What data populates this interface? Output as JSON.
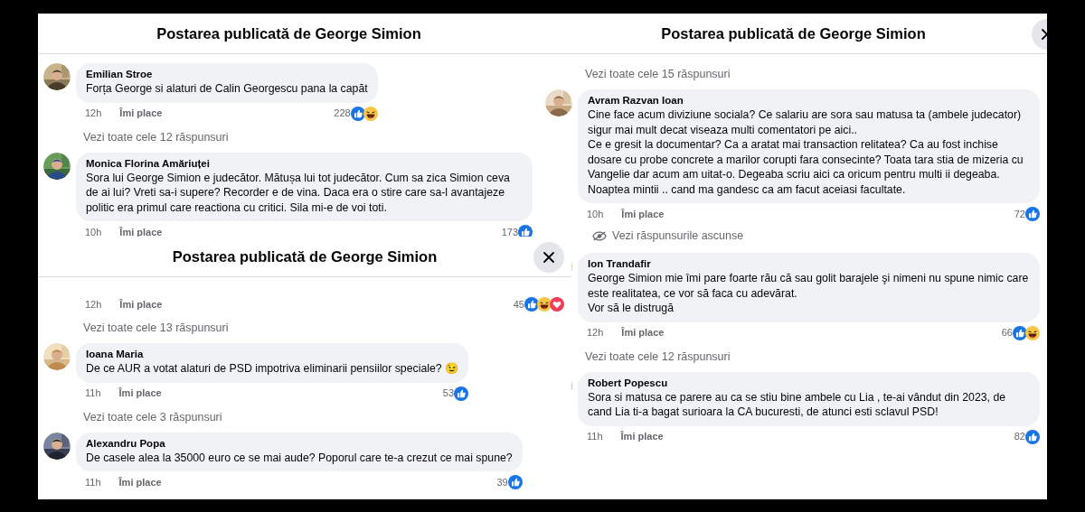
{
  "panels": [
    {
      "title": "Postarea publicată de George Simion",
      "items": [
        {
          "kind": "comment",
          "author": "Emilian Stroe",
          "text": "Forța George si alaturi de Calin Georgescu pana la capăt",
          "time": "12h",
          "like_label": "Îmi place",
          "count": "228",
          "reactions": [
            {
              "kind": "like"
            },
            {
              "kind": "haha"
            }
          ]
        },
        {
          "kind": "replies_link",
          "text": "Vezi toate cele 12 răspunsuri"
        },
        {
          "kind": "comment",
          "author": "Monica Florina Amăriuței",
          "text": "Sora lui George Simion e judecător. Mătușa lui tot judecător. Cum sa zica Simion ceva de ai lui? Vreti sa-i supere? Recorder e de vina. Daca era o stire care sa-l avantajeze politic era primul care reactiona cu critici. Sila mi-e de voi toti.",
          "time": "10h",
          "like_label": "Îmi place",
          "count": "173",
          "reactions": [
            {
              "kind": "like"
            }
          ]
        }
      ]
    },
    {
      "title": "Postarea publicată de George Simion",
      "close_button": true,
      "items": [
        {
          "kind": "comment",
          "time": "12h",
          "like_label": "Îmi place",
          "count": "45",
          "reactions": [
            {
              "kind": "like"
            },
            {
              "kind": "haha"
            },
            {
              "kind": "love"
            }
          ]
        },
        {
          "kind": "replies_link",
          "text": "Vezi toate cele 13 răspunsuri"
        },
        {
          "kind": "comment",
          "author": "Ioana Maria",
          "text": "De ce AUR a votat alaturi de PSD impotriva eliminarii pensiilor speciale? 😉",
          "time": "11h",
          "like_label": "Îmi place",
          "count": "53",
          "reactions": [
            {
              "kind": "like"
            }
          ]
        },
        {
          "kind": "replies_link",
          "text": "Vezi toate cele 3 răspunsuri"
        },
        {
          "kind": "comment",
          "author": "Alexandru Popa",
          "text": "De casele alea la 35000 euro ce se mai aude? Poporul care te-a crezut ce mai spune?",
          "time": "11h",
          "like_label": "Îmi place",
          "count": "39",
          "reactions": [
            {
              "kind": "like"
            }
          ]
        }
      ]
    },
    {
      "title": "Postarea publicată de George Simion",
      "close_button": true,
      "items": [
        {
          "kind": "replies_link",
          "text": "Vezi toate cele 15 răspunsuri"
        },
        {
          "kind": "comment",
          "author": "Avram Razvan Ioan",
          "text": "Cine face acum diviziune sociala? Ce salariu are sora sau matusa ta (ambele judecator) sigur mai mult decat viseaza multi comentatori pe aici..\nCe e gresit la documentar? Ca a aratat mai transaction relitatea? Ca au fost inchise dosare cu probe concrete a marilor corupti fara consecinte? Toata tara stia de mizeria cu Vangelie dar acum am uitat-o. Degeaba scriu aici ca oricum pentru multi ii degeaba. Noaptea mintii .. cand ma gandesc ca am facut aceiasi facultate.",
          "time": "10h",
          "like_label": "Îmi place",
          "count": "72",
          "reactions": [
            {
              "kind": "like"
            }
          ]
        },
        {
          "kind": "hidden_replies",
          "text": "Vezi răspunsurile ascunse"
        },
        {
          "kind": "comment",
          "author": "Ion Trandafir",
          "text": "George Simion mie îmi pare foarte rău că sau golit barajele şi nimeni nu spune nimic care este realitatea, ce vor să faca cu adevărat.\nVor să le distrugă",
          "time": "12h",
          "like_label": "Îmi place",
          "count": "66",
          "reactions": [
            {
              "kind": "like"
            },
            {
              "kind": "haha"
            }
          ]
        },
        {
          "kind": "replies_link",
          "text": "Vezi toate cele 12 răspunsuri"
        },
        {
          "kind": "comment",
          "author": "Robert Popescu",
          "text": "Sora si matusa ce parere au ca se stiu bine ambele cu Lia , te-ai vândut din 2023, de cand Lia ti-a bagat surioara la CA bucuresti, de atunci esti sclavul PSD!",
          "time": "11h",
          "like_label": "Îmi place",
          "count": "82",
          "reactions": [
            {
              "kind": "like"
            }
          ]
        }
      ]
    }
  ]
}
